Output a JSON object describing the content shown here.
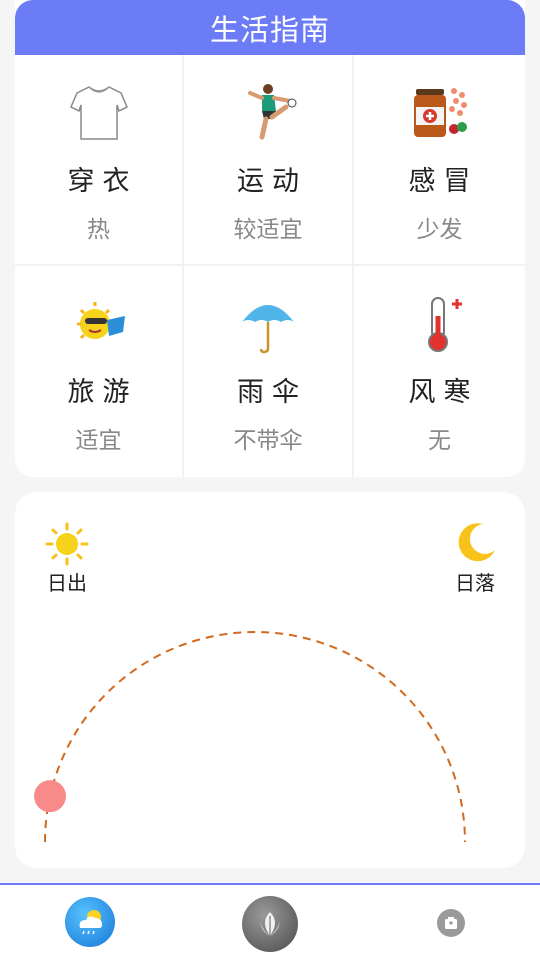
{
  "guide": {
    "title": "生活指南",
    "items": [
      {
        "name": "穿衣",
        "value": "热",
        "icon": "tshirt-icon"
      },
      {
        "name": "运动",
        "value": "较适宜",
        "icon": "soccer-player-icon"
      },
      {
        "name": "感冒",
        "value": "少发",
        "icon": "medicine-icon"
      },
      {
        "name": "旅游",
        "value": "适宜",
        "icon": "sunny-travel-icon"
      },
      {
        "name": "雨伞",
        "value": "不带伞",
        "icon": "umbrella-icon"
      },
      {
        "name": "风寒",
        "value": "无",
        "icon": "thermometer-icon"
      }
    ]
  },
  "sun": {
    "sunrise_label": "日出",
    "sunset_label": "日落",
    "progress": 0.07
  },
  "colors": {
    "accent": "#6c7cf6",
    "arc": "#d2691e",
    "sun_dot": "#f98a8a"
  },
  "nav": {
    "items": [
      "weather-icon",
      "leaf-icon",
      "box-icon"
    ]
  }
}
